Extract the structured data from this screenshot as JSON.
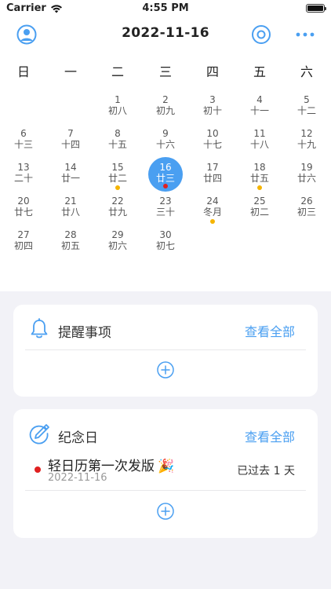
{
  "status_bar": {
    "carrier": "Carrier",
    "time": "4:55 PM"
  },
  "nav": {
    "title": "2022-11-16",
    "icons": [
      "user-circle-icon",
      "target-today-icon",
      "more-dots-icon"
    ]
  },
  "calendar": {
    "weekdays": [
      "日",
      "一",
      "二",
      "三",
      "四",
      "五",
      "六"
    ],
    "selected_day": "16",
    "weeks": [
      [
        null,
        null,
        {
          "day": "1",
          "lunar": "初八"
        },
        {
          "day": "2",
          "lunar": "初九"
        },
        {
          "day": "3",
          "lunar": "初十"
        },
        {
          "day": "4",
          "lunar": "十一"
        },
        {
          "day": "5",
          "lunar": "十二"
        }
      ],
      [
        {
          "day": "6",
          "lunar": "十三"
        },
        {
          "day": "7",
          "lunar": "十四"
        },
        {
          "day": "8",
          "lunar": "十五"
        },
        {
          "day": "9",
          "lunar": "十六"
        },
        {
          "day": "10",
          "lunar": "十七"
        },
        {
          "day": "11",
          "lunar": "十八"
        },
        {
          "day": "12",
          "lunar": "十九"
        }
      ],
      [
        {
          "day": "13",
          "lunar": "二十"
        },
        {
          "day": "14",
          "lunar": "廿一"
        },
        {
          "day": "15",
          "lunar": "廿二",
          "dot": "#f5b400"
        },
        {
          "day": "16",
          "lunar": "廿三",
          "dot": "#e02020",
          "selected": true
        },
        {
          "day": "17",
          "lunar": "廿四"
        },
        {
          "day": "18",
          "lunar": "廿五",
          "dot": "#f5b400"
        },
        {
          "day": "19",
          "lunar": "廿六"
        }
      ],
      [
        {
          "day": "20",
          "lunar": "廿七"
        },
        {
          "day": "21",
          "lunar": "廿八"
        },
        {
          "day": "22",
          "lunar": "廿九"
        },
        {
          "day": "23",
          "lunar": "三十"
        },
        {
          "day": "24",
          "lunar": "冬月",
          "dot": "#f5b400"
        },
        {
          "day": "25",
          "lunar": "初二"
        },
        {
          "day": "26",
          "lunar": "初三"
        }
      ],
      [
        {
          "day": "27",
          "lunar": "初四"
        },
        {
          "day": "28",
          "lunar": "初五"
        },
        {
          "day": "29",
          "lunar": "初六"
        },
        {
          "day": "30",
          "lunar": "初七"
        },
        null,
        null,
        null
      ]
    ]
  },
  "reminders": {
    "title": "提醒事项",
    "view_all": "查看全部",
    "icon": "bell-icon"
  },
  "anniversaries": {
    "title": "纪念日",
    "view_all": "查看全部",
    "icon": "pen-circle-icon",
    "items": [
      {
        "title": "轻日历第一次发版",
        "emoji": "🎉",
        "date": "2022-11-16",
        "status": "已过去 1 天",
        "dot_color": "#e02020"
      }
    ]
  },
  "colors": {
    "accent": "#4a9ff1",
    "event_red": "#e02020",
    "event_yellow": "#f5b400",
    "background": "#f2f2f7"
  }
}
